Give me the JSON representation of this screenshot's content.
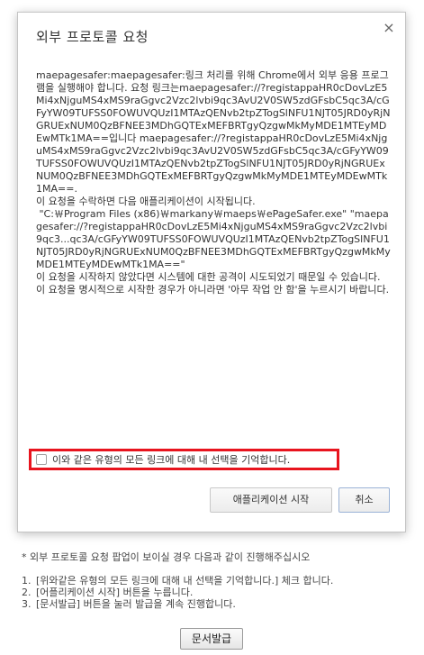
{
  "dialog": {
    "title": "외부 프로토콜 요청",
    "close_glyph": "×",
    "p1": "maepagesafer:maepagesafer:링크 처리를 위해 Chrome에서 외부 응용 프로그램을 실행해야 합니다. 요청 링크는maepagesafer://?registappaHR0cDovLzE5Mi4xNjguMS4xMS9raGgvc2Vzc2lvbi9qc3AvU2V0SW5zdGFsbC5qc3A/cGFyYW09TUFSS0FOWUVQUzI1MTAzQENvb2tpZTogSlNFU1NJT05JRD0yRjNGRUExNUM0QzBFNEE3MDhGQTExMEFBRTgyQzgwMkMyMDE1MTEyMDEwMTk1MA==입니다 maepagesafer://?registappaHR0cDovLzE5Mi4xNjguMS4xMS9raGgvc2Vzc2lvbi9qc3AvU2V0SW5zdGFsbC5qc3A/cGFyYW09TUFSS0FOWUVQUzI1MTAzQENvb2tpZTogSlNFU1NJT05JRD0yRjNGRUExNUM0QzBFNEE3MDhGQTExMEFBRTgyQzgwMkMyMDE1MTEyMDEwMTk1MA==.",
    "p2": "이 요청을 수락하면 다음 애플리케이션이 시작됩니다.",
    "p3": " \"C:￦Program Files (x86)￦markany￦maeps￦ePageSafer.exe\" \"maepagesafer://?registappaHR0cDovLzE5Mi4xNjguMS4xMS9raGgvc2Vzc2lvbi9qc3...qc3A/cGFyYW09TUFSS0FOWUVQUzI1MTAzQENvb2tpZTogSlNFU1NJT05JRD0yRjNGRUExNUM0QzBFNEE3MDhGQTExMEFBRTgyQzgwMkMyMDE1MTEyMDEwMTk1MA==\"",
    "p4": "이 요청을 시작하지 않았다면 시스템에 대한 공격이 시도되었기 때문일 수 있습니다. 이 요청을 명시적으로 시작한 경우가 아니라면 '아무 작업 안 함'을 누르시기 바랍니다.",
    "remember_label": "이와 같은 유형의 모든 링크에 대해 내 선택을 기억합니다.",
    "start_button": "애플리케이션 시작",
    "cancel_button": "취소"
  },
  "instructions": {
    "note": "* 외부 프로토콜 요청 팝업이 보이실 경우 다음과 같이 진행해주십시오",
    "steps": [
      {
        "num": "1.",
        "text": "[위와같은 유형의 모든 링크에 대해 내 선택을 기억합니다.] 체크 합니다."
      },
      {
        "num": "2.",
        "text": "[어플리케이션 시작] 버튼을 누릅니다."
      },
      {
        "num": "3.",
        "text": "[문서발급] 버튼을 눌러 발급을 계속 진행합니다."
      }
    ]
  },
  "issue_button": "문서발급",
  "colors": {
    "highlight_border": "#e8141e",
    "dialog_border": "#c4c4c4"
  }
}
